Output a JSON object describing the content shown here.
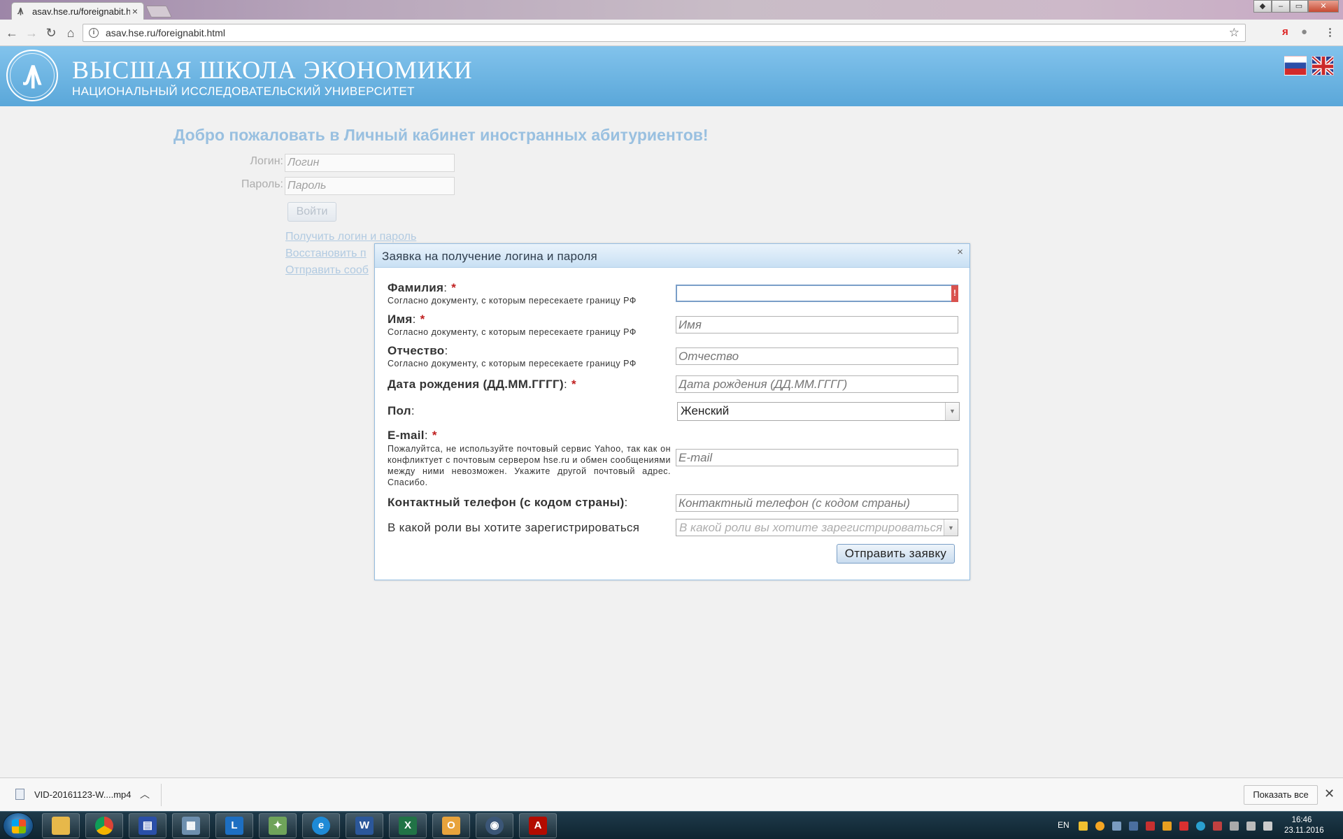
{
  "browser": {
    "tab_title": "asav.hse.ru/foreignabit.html",
    "tab_icon": "hse-favicon",
    "address": "asav.hse.ru/foreignabit.html"
  },
  "header": {
    "title": "ВЫСШАЯ ШКОЛА ЭКОНОМИКИ",
    "subtitle": "НАЦИОНАЛЬНЫЙ ИССЛЕДОВАТЕЛЬСКИЙ УНИВЕРСИТЕТ",
    "logo_letter": "Ꙟ",
    "languages": [
      "ru",
      "en"
    ]
  },
  "page": {
    "welcome": "Добро пожаловать в Личный кабинет иностранных абитуриентов!",
    "login_label": "Логин:",
    "login_placeholder": "Логин",
    "password_label": "Пароль:",
    "password_placeholder": "Пароль",
    "login_button": "Войти",
    "links": [
      "Получить логин и пароль",
      "Восстановить п",
      "Отправить сооб"
    ]
  },
  "modal": {
    "title": "Заявка на получение логина и пароля",
    "close": "×",
    "fields": {
      "surname": {
        "label": "Фамилия",
        "hint": "Согласно документу, с которым пересекаете границу РФ",
        "value": ""
      },
      "name": {
        "label": "Имя",
        "hint": "Согласно документу, с которым пересекаете границу РФ",
        "placeholder": "Имя"
      },
      "patronymic": {
        "label": "Отчество",
        "hint": "Согласно документу, с которым пересекаете границу РФ",
        "placeholder": "Отчество"
      },
      "birthdate": {
        "label": "Дата рождения (ДД.ММ.ГГГГ)",
        "placeholder": "Дата рождения (ДД.ММ.ГГГГ)"
      },
      "gender": {
        "label": "Пол",
        "value": "Женский"
      },
      "email": {
        "label": "E-mail",
        "hint": "Пожалуйтса, не используйте почтовый сервис Yahoo, так как он конфликтует с почтовым сервером hse.ru и обмен сообщениями между ними невозможен. Укажите другой почтовый адрес. Спасибо.",
        "placeholder": "E-mail"
      },
      "phone": {
        "label": "Контактный телефон (с кодом страны)",
        "placeholder": "Контактный телефон (с кодом страны)"
      },
      "role": {
        "label": "В какой роли вы хотите зарегистрироваться",
        "placeholder": "В какой роли вы хотите зарегистрироваться"
      }
    },
    "required_mark": "*",
    "colon": ":",
    "submit": "Отправить заявку"
  },
  "downloads": {
    "file": "VID-20161123-W....mp4",
    "show_all": "Показать все"
  },
  "taskbar": {
    "lang": "EN",
    "time": "16:46",
    "date": "23.11.2016",
    "apps": [
      "explorer",
      "chrome",
      "save",
      "calculator",
      "lync",
      "maps",
      "internet-explorer",
      "word",
      "excel",
      "outlook",
      "camera",
      "acrobat"
    ]
  },
  "colors": {
    "header_blue": "#5aa7d9",
    "welcome_blue": "#6aa6d8",
    "required_red": "#c02020",
    "error_red": "#d9534f"
  }
}
